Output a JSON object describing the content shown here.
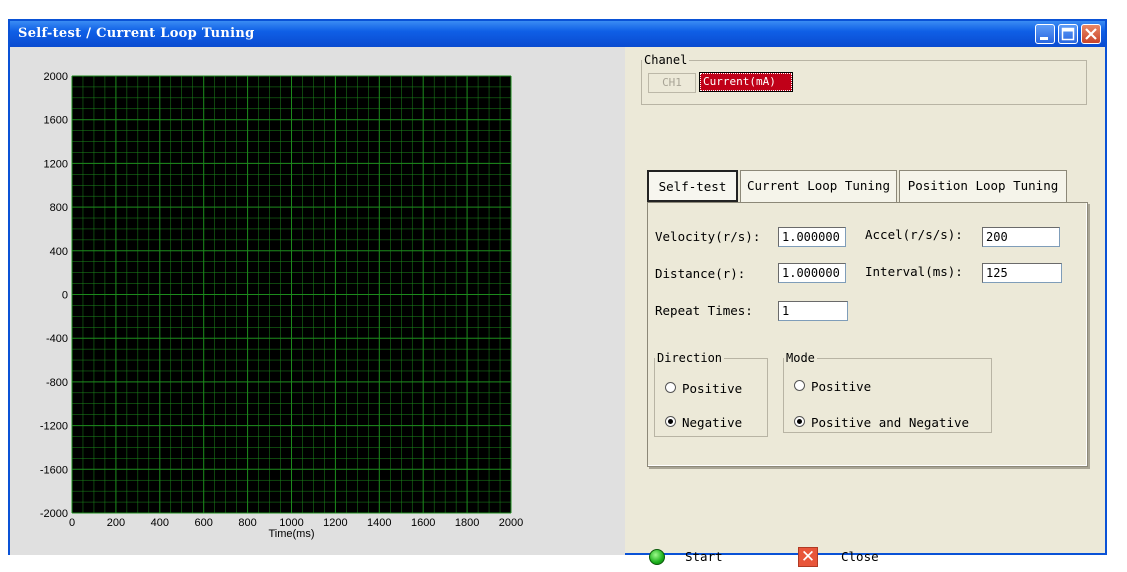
{
  "window": {
    "title": "Self-test / Current Loop Tuning"
  },
  "chart_data": {
    "type": "line",
    "xlabel": "Time(ms)",
    "ylabel": "",
    "xlim": [
      0,
      2000
    ],
    "ylim": [
      -2000,
      2000
    ],
    "x_ticks": [
      "0",
      "200",
      "400",
      "600",
      "800",
      "1000",
      "1200",
      "1400",
      "1600",
      "1800",
      "2000"
    ],
    "y_ticks": [
      "2000",
      "1600",
      "1200",
      "800",
      "400",
      "0",
      "-400",
      "-800",
      "-1200",
      "-1600",
      "-2000"
    ],
    "grid": true,
    "series": [],
    "colors": {
      "background": "#000000",
      "grid": "#1c8a1c"
    }
  },
  "channel": {
    "legend": "Chanel",
    "ch_button": "CH1",
    "selected": "Current(mA)"
  },
  "tabs": [
    {
      "label": "Self-test",
      "active": true
    },
    {
      "label": "Current Loop Tuning",
      "active": false
    },
    {
      "label": "Position Loop Tuning",
      "active": false
    }
  ],
  "form": {
    "velocity_label": "Velocity(r/s):",
    "velocity_value": "1.000000",
    "accel_label": "Accel(r/s/s):",
    "accel_value": "200",
    "distance_label": "Distance(r):",
    "distance_value": "1.000000",
    "interval_label": "Interval(ms):",
    "interval_value": "125",
    "repeat_label": "Repeat Times:",
    "repeat_value": "1"
  },
  "direction": {
    "legend": "Direction",
    "positive": "Positive",
    "negative": "Negative",
    "selected": "negative"
  },
  "mode": {
    "legend": "Mode",
    "positive": "Positive",
    "both": "Positive and Negative",
    "selected": "both"
  },
  "actions": {
    "start": "Start",
    "close": "Close"
  }
}
